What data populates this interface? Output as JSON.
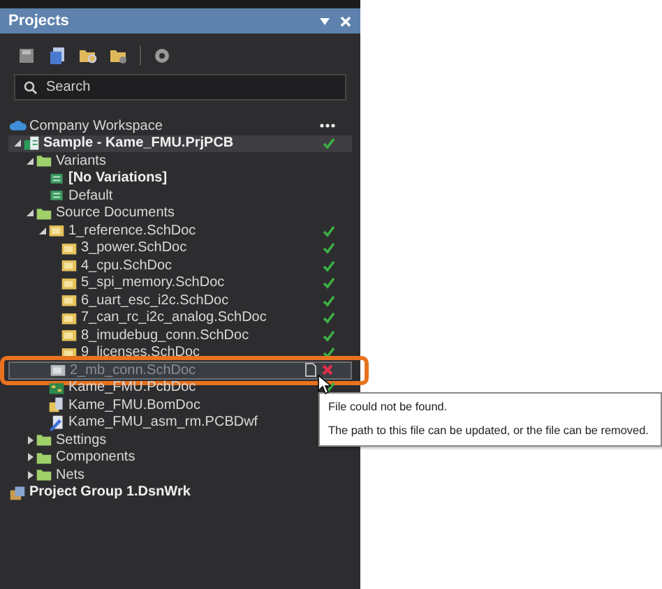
{
  "panel": {
    "title": "Projects"
  },
  "search": {
    "placeholder": "Search"
  },
  "tree": [
    {
      "label": "Company Workspace",
      "kind": "workspace",
      "checked": false
    },
    {
      "label": "Sample - Kame_FMU.PrjPCB",
      "kind": "project",
      "checked": true,
      "expanded": true,
      "selected": true,
      "children": [
        {
          "label": "Variants",
          "kind": "folder",
          "checked": false,
          "expanded": true,
          "children": [
            {
              "label": "[No Variations]",
              "kind": "variant",
              "checked": false,
              "active": true
            },
            {
              "label": "Default",
              "kind": "variant",
              "checked": false,
              "active": false
            }
          ]
        },
        {
          "label": "Source Documents",
          "kind": "folder",
          "checked": false,
          "expanded": true,
          "children": [
            {
              "label": "1_reference.SchDoc",
              "kind": "schdoc",
              "checked": true,
              "expanded": true,
              "children": [
                {
                  "label": "3_power.SchDoc",
                  "kind": "schdoc",
                  "checked": true
                },
                {
                  "label": "4_cpu.SchDoc",
                  "kind": "schdoc",
                  "checked": true
                },
                {
                  "label": "5_spi_memory.SchDoc",
                  "kind": "schdoc",
                  "checked": true
                },
                {
                  "label": "6_uart_esc_i2c.SchDoc",
                  "kind": "schdoc",
                  "checked": true
                },
                {
                  "label": "7_can_rc_i2c_analog.SchDoc",
                  "kind": "schdoc",
                  "checked": true
                },
                {
                  "label": "8_imudebug_conn.SchDoc",
                  "kind": "schdoc",
                  "checked": true
                },
                {
                  "label": "9_licenses.SchDoc",
                  "kind": "schdoc",
                  "checked": true
                }
              ]
            },
            {
              "label": "2_mb_conn.SchDoc",
              "kind": "missing",
              "checked": false
            },
            {
              "label": "Kame_FMU.PcbDoc",
              "kind": "pcbdoc",
              "checked": true
            },
            {
              "label": "Kame_FMU.BomDoc",
              "kind": "bomdoc",
              "checked": false
            },
            {
              "label": "Kame_FMU_asm_rm.PCBDwf",
              "kind": "pcbdwf",
              "checked": false
            }
          ]
        },
        {
          "label": "Settings",
          "kind": "folder",
          "checked": false,
          "expanded": false
        },
        {
          "label": "Components",
          "kind": "folder",
          "checked": false,
          "expanded": false
        },
        {
          "label": "Nets",
          "kind": "folder",
          "checked": false,
          "expanded": false
        }
      ]
    },
    {
      "label": "Project Group 1.DsnWrk",
      "kind": "group",
      "checked": false
    }
  ],
  "tooltip": {
    "lines": [
      "File could not be found.",
      "The path to this file can be updated, or the file can be removed."
    ]
  }
}
